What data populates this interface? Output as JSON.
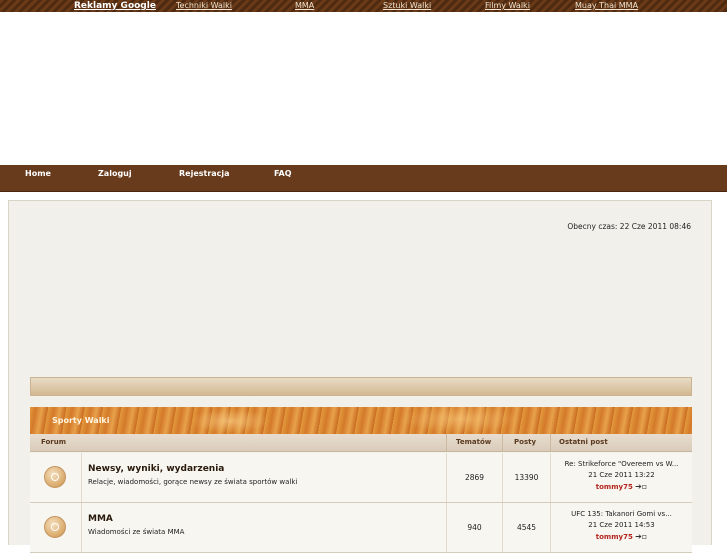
{
  "ad_bar": {
    "heading": "Reklamy Google",
    "links": [
      "Techniki Walki",
      "MMA",
      "Sztuki Walki",
      "Filmy Walki",
      "Muay Thai MMA"
    ]
  },
  "nav": {
    "items": [
      "Home",
      "Zaloguj",
      "Rejestracja",
      "FAQ"
    ]
  },
  "current_time": "Obecny czas: 22 Cze 2011 08:46",
  "category": {
    "title": "Sporty Walki",
    "columns": {
      "forum": "Forum",
      "topics": "Tematów",
      "posts": "Posty",
      "last_post": "Ostatni post"
    },
    "forums": [
      {
        "title": "Newsy, wyniki, wydarzenia",
        "description": "Relacje, wiadomości, gorące newsy ze świata sportów walki",
        "topics": "2869",
        "posts": "13390",
        "last_post_title": "Re: Strikeforce \"Overeem vs W...",
        "last_post_date": "21 Cze 2011 13:22",
        "last_post_user": "tommy75"
      },
      {
        "title": "MMA",
        "description": "Wiadomości ze świata MMA",
        "topics": "940",
        "posts": "4545",
        "last_post_title": "UFC 135: Takanori Gomi vs...",
        "last_post_date": "21 Cze 2011 14:53",
        "last_post_user": "tommy75"
      }
    ]
  },
  "colors": {
    "nav_bar": "#683b1d",
    "category_header": "#d9852f",
    "username": "#b3261e"
  },
  "icons": {
    "forum_status": "forum-read-icon",
    "goto_last_post": "goto-last-post-icon"
  }
}
